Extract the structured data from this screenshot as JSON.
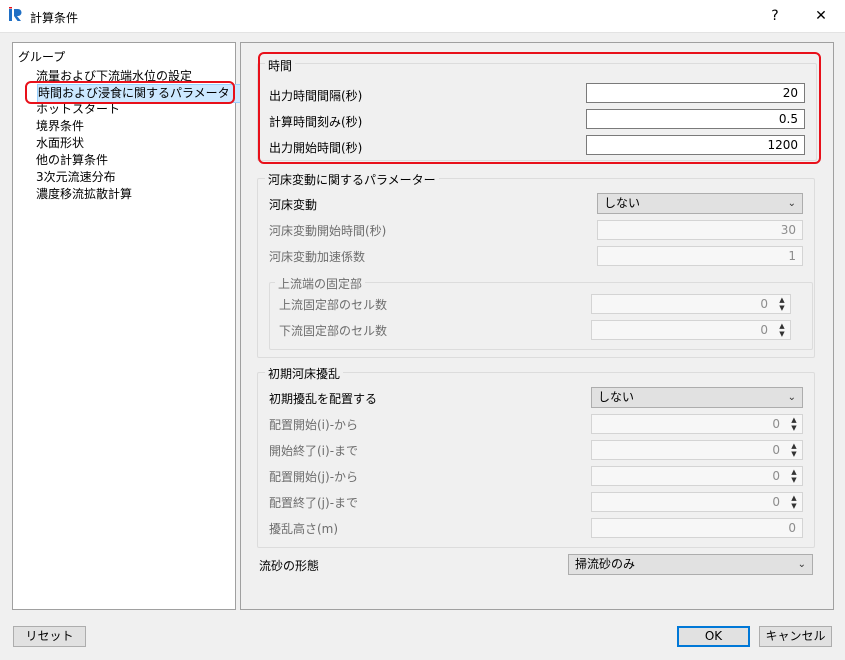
{
  "window": {
    "title": "計算条件",
    "help_label": "?",
    "close_label": "✕"
  },
  "group_panel": {
    "header": "グループ",
    "items": [
      "流量および下流端水位の設定",
      "時間および浸食に関するパラメータ",
      "ホットスタート",
      "境界条件",
      "水面形状",
      "他の計算条件",
      "3次元流速分布",
      "濃度移流拡散計算"
    ]
  },
  "time_group": {
    "title": "時間",
    "rows": [
      {
        "label": "出力時間間隔(秒)",
        "value": "20"
      },
      {
        "label": "計算時間刻み(秒)",
        "value": "0.5"
      },
      {
        "label": "出力開始時間(秒)",
        "value": "1200"
      }
    ]
  },
  "bed_group": {
    "title": "河床変動に関するパラメーター",
    "change_label": "河床変動",
    "change_value": "しない",
    "start_label": "河床変動開始時間(秒)",
    "start_value": "30",
    "accel_label": "河床変動加速係数",
    "accel_value": "1",
    "fixed": {
      "title": "上流端の固定部",
      "upstream_label": "上流固定部のセル数",
      "upstream_value": "0",
      "downstream_label": "下流固定部のセル数",
      "downstream_value": "0"
    }
  },
  "disturb_group": {
    "title": "初期河床擾乱",
    "place_label": "初期擾乱を配置する",
    "place_value": "しない",
    "i_start_label": "配置開始(i)-から",
    "i_start_value": "0",
    "i_end_label": "開始終了(i)-まで",
    "i_end_value": "0",
    "j_start_label": "配置開始(j)-から",
    "j_start_value": "0",
    "j_end_label": "配置終了(j)-まで",
    "j_end_value": "0",
    "height_label": "擾乱高さ(m)",
    "height_value": "0"
  },
  "sediment": {
    "label": "流砂の形態",
    "value": "掃流砂のみ"
  },
  "footer": {
    "reset_label": "リセット",
    "ok_label": "OK",
    "cancel_label": "キャンセル"
  },
  "colors": {
    "highlight": "#e8101a",
    "selection": "#cce8ff",
    "accent": "#0078d7"
  },
  "icons": {
    "app": "iric-logo-icon",
    "dropdown": "chevron-down-icon",
    "spinner": "spin-arrows-icon"
  }
}
